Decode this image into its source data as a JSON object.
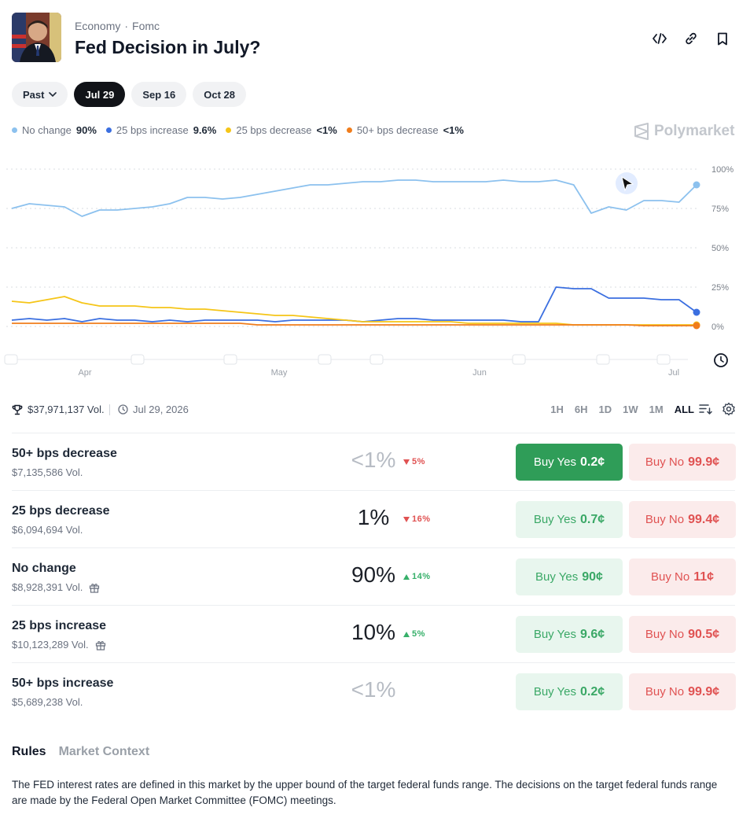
{
  "header": {
    "category": "Economy",
    "subcategory": "Fomc",
    "title": "Fed Decision in July?",
    "icons": [
      "embed-icon",
      "link-icon",
      "bookmark-icon"
    ]
  },
  "date_pills": [
    {
      "label": "Past",
      "active": false,
      "dropdown": true
    },
    {
      "label": "Jul 29",
      "active": true
    },
    {
      "label": "Sep 16",
      "active": false
    },
    {
      "label": "Oct 28",
      "active": false
    }
  ],
  "legend": [
    {
      "name": "No change",
      "value": "90%",
      "color": "#8cc1ee"
    },
    {
      "name": "25 bps increase",
      "value": "9.6%",
      "color": "#3b6fe0"
    },
    {
      "name": "25 bps decrease",
      "value": "<1%",
      "color": "#f5c518"
    },
    {
      "name": "50+ bps decrease",
      "value": "<1%",
      "color": "#f07d1c"
    }
  ],
  "brand": "Polymarket",
  "chart_data": {
    "type": "line",
    "x_ticks": [
      "Apr",
      "May",
      "Jun",
      "Jul"
    ],
    "y_ticks": [
      "100%",
      "75%",
      "50%",
      "25%",
      "0%"
    ],
    "ylim": [
      0,
      100
    ],
    "grid": true,
    "series": [
      {
        "name": "No change",
        "color": "#8cc1ee",
        "values": [
          75,
          78,
          77,
          76,
          70,
          74,
          74,
          75,
          76,
          78,
          82,
          82,
          81,
          82,
          84,
          86,
          88,
          90,
          90,
          91,
          92,
          92,
          93,
          93,
          92,
          92,
          92,
          92,
          93,
          92,
          92,
          93,
          90,
          72,
          76,
          74,
          80,
          80,
          79,
          90
        ]
      },
      {
        "name": "25 bps increase",
        "color": "#3b6fe0",
        "values": [
          4,
          5,
          4,
          5,
          3,
          5,
          4,
          4,
          3,
          4,
          3,
          4,
          4,
          4,
          4,
          3,
          4,
          4,
          4,
          4,
          3,
          4,
          5,
          5,
          4,
          4,
          4,
          4,
          4,
          3,
          3,
          25,
          24,
          24,
          18,
          18,
          18,
          17,
          17,
          9
        ]
      },
      {
        "name": "25 bps decrease",
        "color": "#f5c518",
        "values": [
          16,
          15,
          17,
          19,
          15,
          13,
          13,
          13,
          12,
          12,
          11,
          11,
          10,
          9,
          8,
          7,
          7,
          6,
          5,
          4,
          3,
          3,
          3,
          3,
          3,
          3,
          2,
          2,
          2,
          2,
          2,
          2,
          1,
          1,
          1,
          1,
          1,
          1,
          1,
          1
        ]
      },
      {
        "name": "50+ bps decrease",
        "color": "#f07d1c",
        "values": [
          2,
          2,
          2,
          2,
          2,
          2,
          2,
          2,
          2,
          2,
          2,
          2,
          2,
          2,
          1,
          1,
          1,
          1,
          1,
          1,
          1,
          1,
          1,
          1,
          1,
          1,
          1,
          1,
          1,
          1,
          1,
          1,
          1,
          1,
          1,
          1,
          0.5,
          0.5,
          0.5,
          0.5
        ]
      }
    ]
  },
  "meta": {
    "volume": "$37,971,137 Vol.",
    "date": "Jul 29, 2026",
    "ranges": [
      "1H",
      "6H",
      "1D",
      "1W",
      "1M",
      "ALL"
    ],
    "active_range": "ALL"
  },
  "outcomes": [
    {
      "name": "50+ bps decrease",
      "vol": "$7,135,586 Vol.",
      "pct": "<1%",
      "dim": true,
      "change": "5%",
      "dir": "down",
      "yes_label": "Buy Yes",
      "yes_price": "0.2¢",
      "no_label": "Buy No",
      "no_price": "99.9¢",
      "gift": false,
      "solid": true
    },
    {
      "name": "25 bps decrease",
      "vol": "$6,094,694 Vol.",
      "pct": "1%",
      "dim": false,
      "change": "16%",
      "dir": "down",
      "yes_label": "Buy Yes",
      "yes_price": "0.7¢",
      "no_label": "Buy No",
      "no_price": "99.4¢",
      "gift": false,
      "solid": false
    },
    {
      "name": "No change",
      "vol": "$8,928,391 Vol.",
      "pct": "90%",
      "dim": false,
      "change": "14%",
      "dir": "up",
      "yes_label": "Buy Yes",
      "yes_price": "90¢",
      "no_label": "Buy No",
      "no_price": "11¢",
      "gift": true,
      "solid": false
    },
    {
      "name": "25 bps increase",
      "vol": "$10,123,289 Vol.",
      "pct": "10%",
      "dim": false,
      "change": "5%",
      "dir": "up",
      "yes_label": "Buy Yes",
      "yes_price": "9.6¢",
      "no_label": "Buy No",
      "no_price": "90.5¢",
      "gift": true,
      "solid": false
    },
    {
      "name": "50+ bps increase",
      "vol": "$5,689,238 Vol.",
      "pct": "<1%",
      "dim": true,
      "change": "",
      "dir": "",
      "yes_label": "Buy Yes",
      "yes_price": "0.2¢",
      "no_label": "Buy No",
      "no_price": "99.9¢",
      "gift": false,
      "solid": false
    }
  ],
  "tabs": [
    {
      "label": "Rules",
      "active": true
    },
    {
      "label": "Market Context",
      "active": false
    }
  ],
  "rules_text": "The FED interest rates are defined in this market by the upper bound of the target federal funds range. The decisions on the target federal funds range are made by the Federal Open Market Committee (FOMC) meetings."
}
